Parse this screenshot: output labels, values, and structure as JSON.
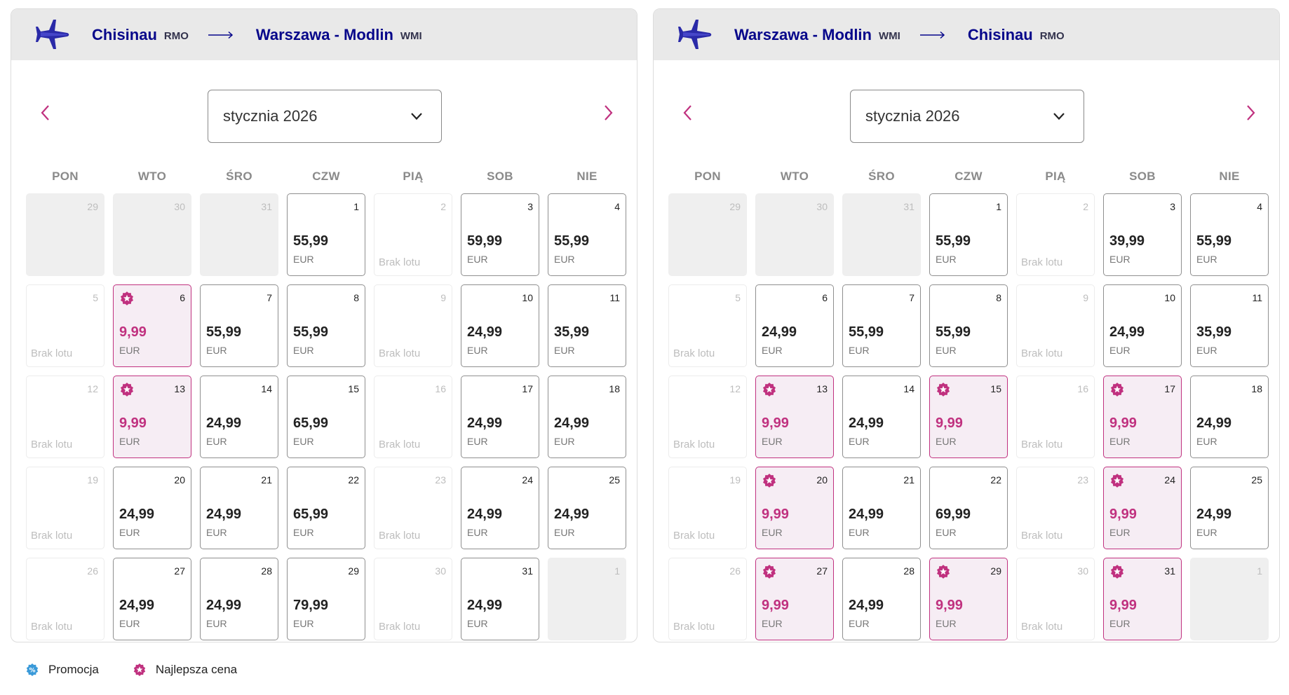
{
  "colors": {
    "brand_navy": "#06068a",
    "best_price": "#c0317f",
    "promo": "#3a9ad9"
  },
  "legend": {
    "promo_label": "Promocja",
    "best_label": "Najlepsza cena"
  },
  "panels": [
    {
      "from_city": "Chisinau",
      "from_code": "RMO",
      "to_city": "Warszawa - Modlin",
      "to_code": "WMI",
      "month_label": "stycznia 2026",
      "weekdays": [
        "PON",
        "WTO",
        "ŚRO",
        "CZW",
        "PIĄ",
        "SOB",
        "NIE"
      ],
      "weeks": [
        [
          {
            "day": "29",
            "type": "outside"
          },
          {
            "day": "30",
            "type": "outside"
          },
          {
            "day": "31",
            "type": "outside"
          },
          {
            "day": "1",
            "type": "fly",
            "price": "55,99",
            "currency": "EUR"
          },
          {
            "day": "2",
            "type": "nofly",
            "note": "Brak lotu"
          },
          {
            "day": "3",
            "type": "fly",
            "price": "59,99",
            "currency": "EUR"
          },
          {
            "day": "4",
            "type": "fly",
            "price": "55,99",
            "currency": "EUR"
          }
        ],
        [
          {
            "day": "5",
            "type": "nofly",
            "note": "Brak lotu"
          },
          {
            "day": "6",
            "type": "best",
            "price": "9,99",
            "currency": "EUR"
          },
          {
            "day": "7",
            "type": "fly",
            "price": "55,99",
            "currency": "EUR"
          },
          {
            "day": "8",
            "type": "fly",
            "price": "55,99",
            "currency": "EUR"
          },
          {
            "day": "9",
            "type": "nofly",
            "note": "Brak lotu"
          },
          {
            "day": "10",
            "type": "fly",
            "price": "24,99",
            "currency": "EUR"
          },
          {
            "day": "11",
            "type": "fly",
            "price": "35,99",
            "currency": "EUR"
          }
        ],
        [
          {
            "day": "12",
            "type": "nofly",
            "note": "Brak lotu"
          },
          {
            "day": "13",
            "type": "best",
            "price": "9,99",
            "currency": "EUR"
          },
          {
            "day": "14",
            "type": "fly",
            "price": "24,99",
            "currency": "EUR"
          },
          {
            "day": "15",
            "type": "fly",
            "price": "65,99",
            "currency": "EUR"
          },
          {
            "day": "16",
            "type": "nofly",
            "note": "Brak lotu"
          },
          {
            "day": "17",
            "type": "fly",
            "price": "24,99",
            "currency": "EUR"
          },
          {
            "day": "18",
            "type": "fly",
            "price": "24,99",
            "currency": "EUR"
          }
        ],
        [
          {
            "day": "19",
            "type": "nofly",
            "note": "Brak lotu"
          },
          {
            "day": "20",
            "type": "fly",
            "price": "24,99",
            "currency": "EUR"
          },
          {
            "day": "21",
            "type": "fly",
            "price": "24,99",
            "currency": "EUR"
          },
          {
            "day": "22",
            "type": "fly",
            "price": "65,99",
            "currency": "EUR"
          },
          {
            "day": "23",
            "type": "nofly",
            "note": "Brak lotu"
          },
          {
            "day": "24",
            "type": "fly",
            "price": "24,99",
            "currency": "EUR"
          },
          {
            "day": "25",
            "type": "fly",
            "price": "24,99",
            "currency": "EUR"
          }
        ],
        [
          {
            "day": "26",
            "type": "nofly",
            "note": "Brak lotu"
          },
          {
            "day": "27",
            "type": "fly",
            "price": "24,99",
            "currency": "EUR"
          },
          {
            "day": "28",
            "type": "fly",
            "price": "24,99",
            "currency": "EUR"
          },
          {
            "day": "29",
            "type": "fly",
            "price": "79,99",
            "currency": "EUR"
          },
          {
            "day": "30",
            "type": "nofly",
            "note": "Brak lotu"
          },
          {
            "day": "31",
            "type": "fly",
            "price": "24,99",
            "currency": "EUR"
          },
          {
            "day": "1",
            "type": "outside"
          }
        ]
      ]
    },
    {
      "from_city": "Warszawa - Modlin",
      "from_code": "WMI",
      "to_city": "Chisinau",
      "to_code": "RMO",
      "month_label": "stycznia 2026",
      "weekdays": [
        "PON",
        "WTO",
        "ŚRO",
        "CZW",
        "PIĄ",
        "SOB",
        "NIE"
      ],
      "weeks": [
        [
          {
            "day": "29",
            "type": "outside"
          },
          {
            "day": "30",
            "type": "outside"
          },
          {
            "day": "31",
            "type": "outside"
          },
          {
            "day": "1",
            "type": "fly",
            "price": "55,99",
            "currency": "EUR"
          },
          {
            "day": "2",
            "type": "nofly",
            "note": "Brak lotu"
          },
          {
            "day": "3",
            "type": "fly",
            "price": "39,99",
            "currency": "EUR"
          },
          {
            "day": "4",
            "type": "fly",
            "price": "55,99",
            "currency": "EUR"
          }
        ],
        [
          {
            "day": "5",
            "type": "nofly",
            "note": "Brak lotu"
          },
          {
            "day": "6",
            "type": "fly",
            "price": "24,99",
            "currency": "EUR"
          },
          {
            "day": "7",
            "type": "fly",
            "price": "55,99",
            "currency": "EUR"
          },
          {
            "day": "8",
            "type": "fly",
            "price": "55,99",
            "currency": "EUR"
          },
          {
            "day": "9",
            "type": "nofly",
            "note": "Brak lotu"
          },
          {
            "day": "10",
            "type": "fly",
            "price": "24,99",
            "currency": "EUR"
          },
          {
            "day": "11",
            "type": "fly",
            "price": "35,99",
            "currency": "EUR"
          }
        ],
        [
          {
            "day": "12",
            "type": "nofly",
            "note": "Brak lotu"
          },
          {
            "day": "13",
            "type": "best",
            "price": "9,99",
            "currency": "EUR"
          },
          {
            "day": "14",
            "type": "fly",
            "price": "24,99",
            "currency": "EUR"
          },
          {
            "day": "15",
            "type": "best",
            "price": "9,99",
            "currency": "EUR"
          },
          {
            "day": "16",
            "type": "nofly",
            "note": "Brak lotu"
          },
          {
            "day": "17",
            "type": "best",
            "price": "9,99",
            "currency": "EUR"
          },
          {
            "day": "18",
            "type": "fly",
            "price": "24,99",
            "currency": "EUR"
          }
        ],
        [
          {
            "day": "19",
            "type": "nofly",
            "note": "Brak lotu"
          },
          {
            "day": "20",
            "type": "best",
            "price": "9,99",
            "currency": "EUR"
          },
          {
            "day": "21",
            "type": "fly",
            "price": "24,99",
            "currency": "EUR"
          },
          {
            "day": "22",
            "type": "fly",
            "price": "69,99",
            "currency": "EUR"
          },
          {
            "day": "23",
            "type": "nofly",
            "note": "Brak lotu"
          },
          {
            "day": "24",
            "type": "best",
            "price": "9,99",
            "currency": "EUR"
          },
          {
            "day": "25",
            "type": "fly",
            "price": "24,99",
            "currency": "EUR"
          }
        ],
        [
          {
            "day": "26",
            "type": "nofly",
            "note": "Brak lotu"
          },
          {
            "day": "27",
            "type": "best",
            "price": "9,99",
            "currency": "EUR"
          },
          {
            "day": "28",
            "type": "fly",
            "price": "24,99",
            "currency": "EUR"
          },
          {
            "day": "29",
            "type": "best",
            "price": "9,99",
            "currency": "EUR"
          },
          {
            "day": "30",
            "type": "nofly",
            "note": "Brak lotu"
          },
          {
            "day": "31",
            "type": "best",
            "price": "9,99",
            "currency": "EUR"
          },
          {
            "day": "1",
            "type": "outside"
          }
        ]
      ]
    }
  ]
}
